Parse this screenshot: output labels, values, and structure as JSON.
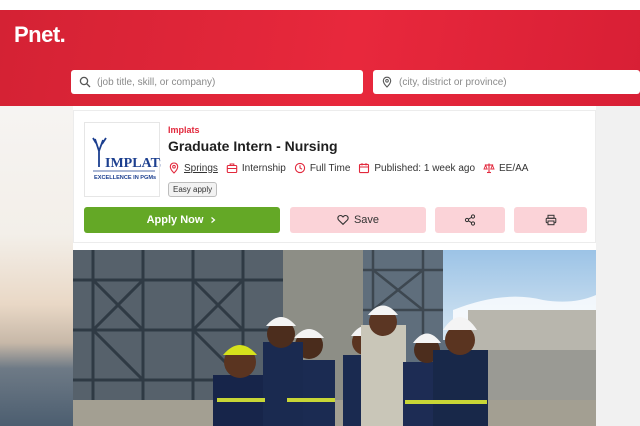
{
  "brand": {
    "logo": "Pnet."
  },
  "search": {
    "keyword_placeholder": "(job title, skill, or company)",
    "location_placeholder": "(city, district or province)"
  },
  "job": {
    "company": "Implats",
    "title": "Graduate Intern - Nursing",
    "location": "Springs",
    "type": "Internship",
    "schedule": "Full Time",
    "published": "Published: 1 week ago",
    "equity": "EE/AA",
    "badge": "Easy apply"
  },
  "company_logo": {
    "name": "IMPLATS",
    "tagline": "EXCELLENCE IN PGMs"
  },
  "actions": {
    "apply_label": "Apply Now",
    "save_label": "Save"
  },
  "icons": {
    "keyword": "search-icon",
    "location": "location-pin-icon",
    "type": "briefcase-icon",
    "schedule": "clock-icon",
    "published": "calendar-icon",
    "equity": "scales-icon",
    "save": "heart-icon",
    "share": "share-icon",
    "print": "printer-icon",
    "apply": "chevron-right-icon"
  },
  "colors": {
    "brand_red": "#e2283c",
    "apply_green": "#64a826",
    "secondary_pink": "#fbd3d8"
  }
}
